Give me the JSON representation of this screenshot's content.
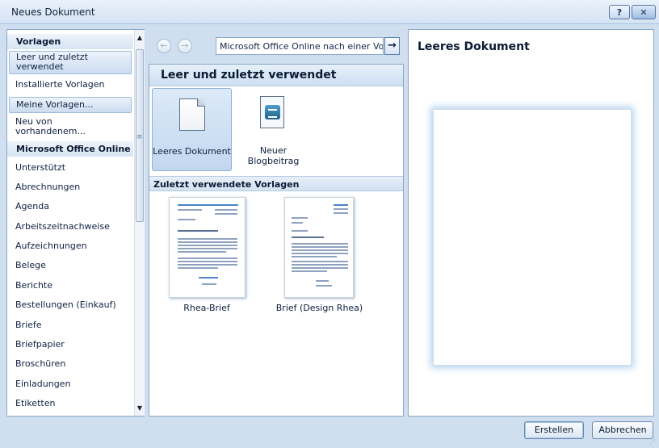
{
  "window": {
    "title": "Neues Dokument",
    "help_symbol": "?",
    "close_symbol": "✕"
  },
  "sidebar": {
    "items": [
      {
        "label": "Vorlagen",
        "kind": "header"
      },
      {
        "label": "Leer und zuletzt verwendet",
        "kind": "item",
        "selected": true
      },
      {
        "label": "Installierte Vorlagen",
        "kind": "item"
      },
      {
        "label": "Meine Vorlagen...",
        "kind": "item",
        "highlighted": true
      },
      {
        "label": "Neu von vorhandenem...",
        "kind": "item"
      },
      {
        "label": "Microsoft Office Online",
        "kind": "header"
      },
      {
        "label": "Unterstützt",
        "kind": "item"
      },
      {
        "label": "Abrechnungen",
        "kind": "item"
      },
      {
        "label": "Agenda",
        "kind": "item"
      },
      {
        "label": "Arbeitszeitnachweise",
        "kind": "item"
      },
      {
        "label": "Aufzeichnungen",
        "kind": "item"
      },
      {
        "label": "Belege",
        "kind": "item"
      },
      {
        "label": "Berichte",
        "kind": "item"
      },
      {
        "label": "Bestellungen (Einkauf)",
        "kind": "item"
      },
      {
        "label": "Briefe",
        "kind": "item"
      },
      {
        "label": "Briefpapier",
        "kind": "item"
      },
      {
        "label": "Broschüren",
        "kind": "item"
      },
      {
        "label": "Einladungen",
        "kind": "item"
      },
      {
        "label": "Etiketten",
        "kind": "item"
      }
    ]
  },
  "nav": {
    "back_symbol": "←",
    "forward_symbol": "→",
    "search_value": "Microsoft Office Online nach einer Vo",
    "go_symbol": "→"
  },
  "middle": {
    "title": "Leer und zuletzt verwendet",
    "tiles": [
      {
        "label": "Leeres Dokument",
        "icon": "blank-document-icon",
        "selected": true
      },
      {
        "label": "Neuer Blogbeitrag",
        "icon": "blog-post-icon"
      }
    ],
    "recent_header": "Zuletzt verwendete Vorlagen",
    "recent": [
      {
        "label": "Rhea-Brief"
      },
      {
        "label": "Brief (Design Rhea)"
      }
    ]
  },
  "preview": {
    "title": "Leeres Dokument"
  },
  "buttons": {
    "create": "Erstellen",
    "cancel": "Abbrechen"
  },
  "colors": {
    "frame": "#cfdff0",
    "selection": "#c2d7ef",
    "border": "#8aa7c8"
  }
}
